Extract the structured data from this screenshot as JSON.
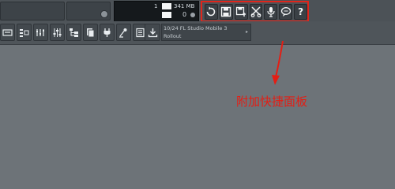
{
  "monitor": {
    "cpu_value": "1",
    "memory_value": "341 MB",
    "polyphony": "0"
  },
  "quick_panel": {
    "buttons": [
      {
        "icon": "undo-icon"
      },
      {
        "icon": "save-icon"
      },
      {
        "icon": "save-as-icon"
      },
      {
        "icon": "cut-icon"
      },
      {
        "icon": "microphone-icon"
      },
      {
        "icon": "chat-icon"
      },
      {
        "icon": "help-icon",
        "label": "?"
      }
    ]
  },
  "toolbar": {
    "hint_line1": "10/24  FL Studio Mobile 3",
    "hint_line2": "Rollout"
  },
  "annotation": {
    "text": "附加快捷面板",
    "color": "#e41e14"
  }
}
